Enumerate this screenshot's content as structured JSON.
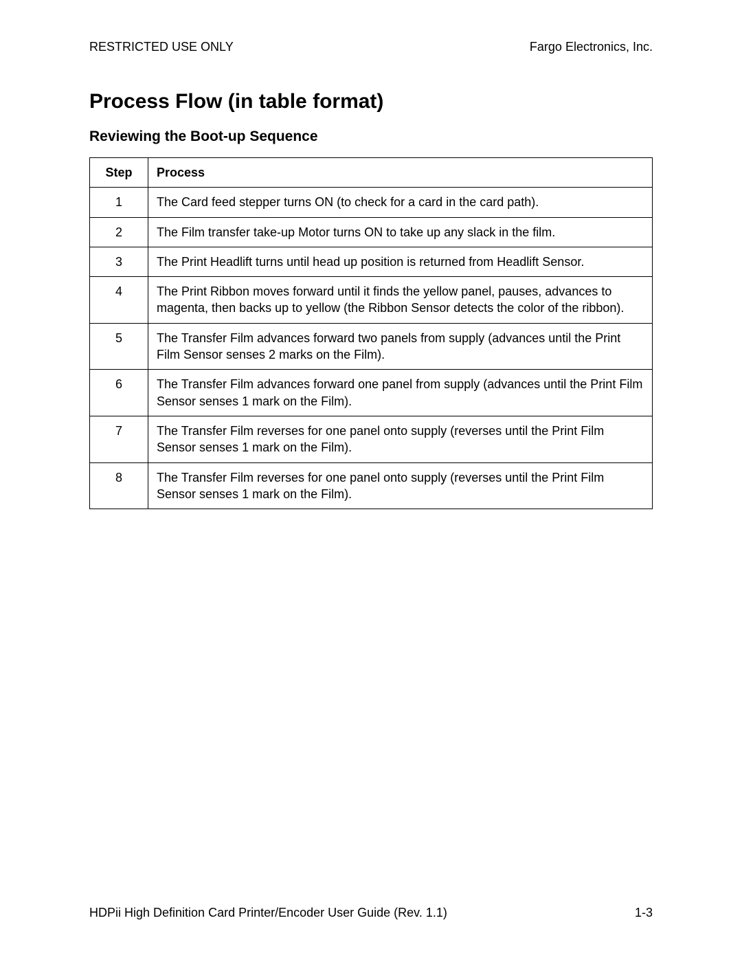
{
  "header": {
    "left": "RESTRICTED USE ONLY",
    "right": "Fargo Electronics, Inc."
  },
  "page_title": "Process Flow (in table format)",
  "section_title": "Reviewing the Boot-up Sequence",
  "table": {
    "headers": {
      "step": "Step",
      "process": "Process"
    },
    "rows": [
      {
        "step": "1",
        "process": "The Card feed stepper turns ON (to check for a card in the card path)."
      },
      {
        "step": "2",
        "process": "The Film transfer take-up Motor turns ON to take up any slack in the film."
      },
      {
        "step": "3",
        "process": "The Print Headlift turns until head up position is returned from Headlift Sensor."
      },
      {
        "step": "4",
        "process": "The Print Ribbon moves forward until it finds the yellow panel, pauses, advances to magenta, then backs up to yellow (the Ribbon Sensor detects the color of the ribbon)."
      },
      {
        "step": "5",
        "process": "The Transfer Film advances forward two panels from supply (advances until the Print Film Sensor senses 2 marks on the Film)."
      },
      {
        "step": "6",
        "process": "The Transfer Film advances forward one panel from supply (advances until the Print Film Sensor senses 1 mark on the Film)."
      },
      {
        "step": "7",
        "process": "The Transfer Film reverses for one panel onto supply (reverses until the Print Film Sensor senses 1 mark on the Film)."
      },
      {
        "step": "8",
        "process": "The Transfer Film reverses for one panel onto supply (reverses until the Print Film Sensor senses 1 mark on the Film)."
      }
    ]
  },
  "footer": {
    "left": "HDPii High Definition Card Printer/Encoder User Guide (Rev. 1.1)",
    "right": "1-3"
  }
}
